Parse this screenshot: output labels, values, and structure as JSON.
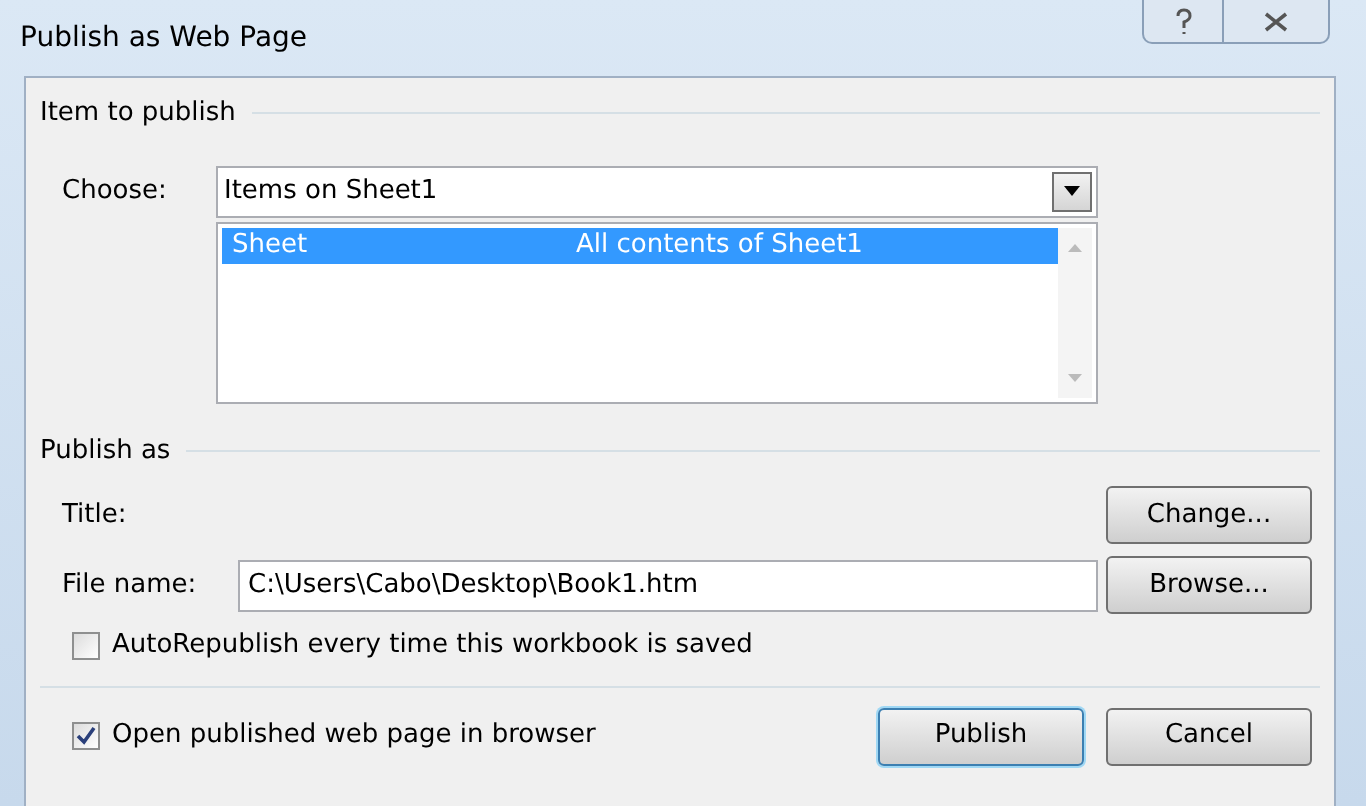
{
  "window": {
    "title": "Publish as Web Page"
  },
  "item_to_publish": {
    "heading": "Item to publish",
    "choose_label": "Choose:",
    "choose_value": "Items on Sheet1",
    "items": [
      {
        "name": "Sheet",
        "description": "All contents of Sheet1",
        "selected": true
      }
    ]
  },
  "publish_as": {
    "heading": "Publish as",
    "title_label": "Title:",
    "change_button": "Change...",
    "file_name_label": "File name:",
    "file_name_value": "C:\\Users\\Cabo\\Desktop\\Book1.htm",
    "browse_button": "Browse...",
    "autorepublish": {
      "label": "AutoRepublish every time this workbook is saved",
      "checked": false
    }
  },
  "open_in_browser": {
    "label": "Open published web page in browser",
    "checked": true
  },
  "buttons": [
    {
      "label": "Publish",
      "default": true
    },
    {
      "label": "Cancel",
      "default": false
    }
  ]
}
